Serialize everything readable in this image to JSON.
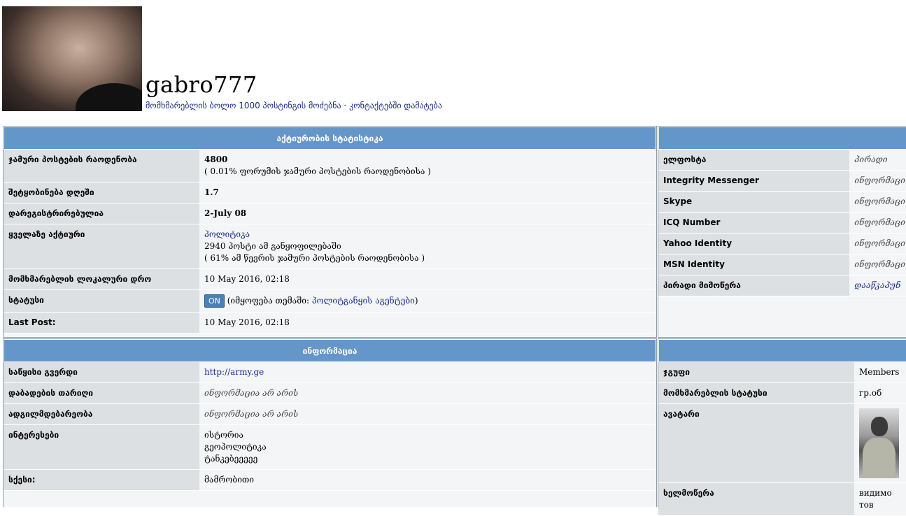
{
  "profile": {
    "username": "gabro777",
    "link_posts": "მომხმარებლის ბოლო 1000 პოსტინგის მოძებნა",
    "separator": "·",
    "link_contacts": "კონტაქტებში დამატება"
  },
  "activity": {
    "title": "აქტიურობის სტატისტიკა",
    "total_posts_label": "ჯამური პოსტების რაოდენობა",
    "total_posts_value": "4800",
    "total_posts_note": "( 0.01% ფორუმის ჯამური პოსტების რაოდენობისა )",
    "per_day_label": "შეტყობინება დღეში",
    "per_day_value": "1.7",
    "registered_label": "დარეგისტრირებულია",
    "registered_value": "2-July 08",
    "most_active_label": "ყველაზე აქტიური",
    "most_active_forum": "პოლიტიკა",
    "most_active_count": "2940 პოსტი ამ განყოფილებაში",
    "most_active_note": "( 61% ამ წევრის ჯამური პოსტების რაოდენობისა )",
    "local_time_label": "მომხმარებლის ლოკალური დრო",
    "local_time_value": "10 May 2016, 02:18",
    "status_label": "სტატუსი",
    "status_badge": "ON",
    "status_prefix": "(იმყოფება თემაში:",
    "status_topic": "პოლიტგანყის აგენტები",
    "status_suffix": ")",
    "last_post_label": "Last Post:",
    "last_post_value": "10 May 2016, 02:18"
  },
  "contact": {
    "rows": [
      {
        "label": "ელფოსტა",
        "value": "პირადი"
      },
      {
        "label": "Integrity Messenger",
        "value": "ინფორმაცი"
      },
      {
        "label": "Skype",
        "value": "ინფორმაცი"
      },
      {
        "label": "ICQ Number",
        "value": "ინფორმაცი"
      },
      {
        "label": "Yahoo Identity",
        "value": "ინფორმაცი"
      },
      {
        "label": "MSN Identity",
        "value": "ინფორმაცი"
      },
      {
        "label": "პირადი მიმოწერა",
        "value": "დააწკაპუნ"
      }
    ]
  },
  "info": {
    "title": "ინფორმაცია",
    "homepage_label": "საწყისი გვერდი",
    "homepage_value": "http://army.ge",
    "birthday_label": "დაბადების თარიღი",
    "birthday_value": "ინფორმაცია არ არის",
    "location_label": "ადგილმდებარეობა",
    "location_value": "ინფორმაცია არ არის",
    "interests_label": "ინტერესები",
    "interests_1": "ისტორია",
    "interests_2": "გეოპოლიტიკა",
    "interests_3": "ტანკებეეეეე",
    "gender_label": "სქესი:",
    "gender_value": "მამრობითი"
  },
  "member": {
    "group_label": "ჯგუფი",
    "group_value": "Members",
    "user_status_label": "მომხმარებლის სტატუსი",
    "user_status_value": "гр.об",
    "avatar_label": "ავატარი",
    "signature_label": "ხელმოწერა",
    "signature_value": "видимо тов"
  }
}
